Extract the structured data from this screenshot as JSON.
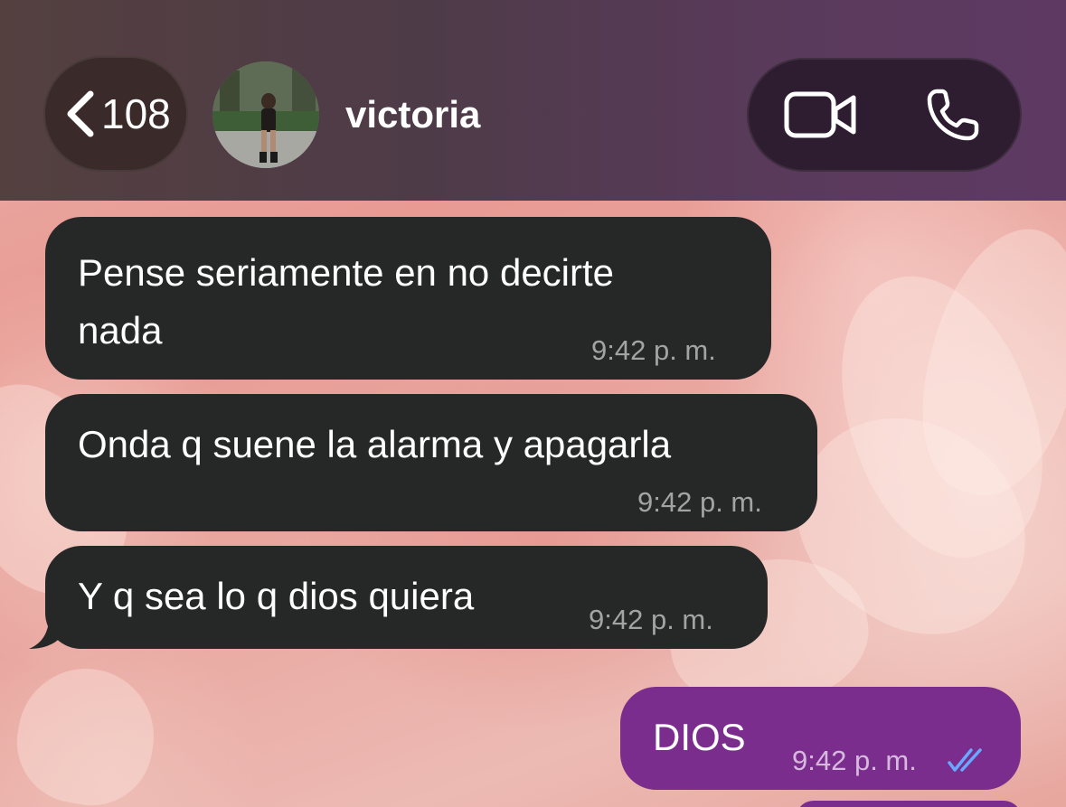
{
  "header": {
    "back_count": "108",
    "contact_name": "victoria",
    "icons": {
      "back": "chevron-left-icon",
      "video": "video-call-icon",
      "phone": "phone-icon"
    }
  },
  "messages": [
    {
      "direction": "incoming",
      "lines": [
        "Pense seriamente en no decirte",
        "nada"
      ],
      "time": "9:42 p. m."
    },
    {
      "direction": "incoming",
      "lines": [
        "Onda q suene la alarma y apagarla"
      ],
      "time": "9:42 p. m."
    },
    {
      "direction": "incoming",
      "lines": [
        "Y q sea lo q dios quiera"
      ],
      "time": "9:42 p. m."
    },
    {
      "direction": "outgoing",
      "lines": [
        "DIOS"
      ],
      "time": "9:42 p. m.",
      "status_icon": "double-check-icon",
      "status": "read"
    }
  ],
  "colors": {
    "incoming_bubble": "#262727",
    "outgoing_bubble": "#7a2d8c",
    "read_check": "#6aa8ff"
  }
}
